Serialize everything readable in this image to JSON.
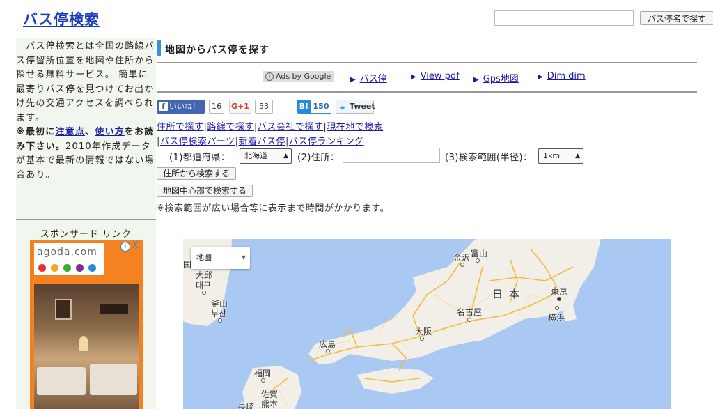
{
  "header": {
    "site_title": "バス停検索",
    "search_button": "バス停名で探す"
  },
  "sidebar": {
    "intro_1": "　バス停検索とは全国の路線バス停留所位置を地図や住所から探せる無料サービス。 簡単に最寄りバス停を見つけてお出かけ先の交通アクセスを調べられます。",
    "intro_2a": "※最初に",
    "intro_link1": "注意点",
    "intro_2b": "、",
    "intro_link2": "使い方",
    "intro_2c": "をお読み下さい。",
    "intro_3": "2010年作成データが基本で最新の情報ではない場合あり。",
    "sponsor_label": "スポンサード リンク",
    "ad": {
      "logo": "agoda.com",
      "info": "i",
      "close": "X",
      "dot_colors": [
        "#e5322d",
        "#f5a623",
        "#3aaa35",
        "#7b2d8e",
        "#2a8ad6"
      ]
    }
  },
  "main": {
    "heading": "地図からバス停を探す",
    "ads_by_google": "Ads by Google",
    "ad_links": [
      "バス停",
      "View pdf",
      "Gps地図",
      "Dim dim"
    ],
    "social": {
      "fb_label": "いいね！",
      "fb_count": "16",
      "gplus_label": "G+1",
      "gplus_count": "53",
      "hatena_label": "B!",
      "hatena_count": "150",
      "tweet_label": "Tweet"
    },
    "nav1": {
      "items": [
        "住所で探す",
        "路線で探す",
        "バス会社で探す",
        "現在地で検索"
      ]
    },
    "nav2": {
      "items": [
        "バス停検索パーツ",
        "新着バス停",
        "バス停ランキング"
      ]
    },
    "form": {
      "pref_label": "(1)都道府県：",
      "pref_value": "北海道",
      "address_label": "(2)住所：",
      "range_label": "(3)検索範囲(半径)：",
      "range_value": "1km",
      "search_address_btn": "住所から検索する",
      "search_center_btn": "地図中心部で検索する",
      "note": "※検索範囲が広い場合等に表示まで時間がかかります。"
    },
    "map": {
      "type_selector": "地圖",
      "labels": {
        "kanazawa": "金沢",
        "toyama": "富山",
        "nihon": "日 本",
        "tokyo": "東京",
        "yokohama": "横浜",
        "nagoya": "名古屋",
        "osaka": "大阪",
        "hiroshima": "広島",
        "fukuoka": "福岡",
        "saga": "佐賀",
        "kumamoto": "熊本",
        "nagasaki": "長崎",
        "daegu": "大邱",
        "daegu2": "대구",
        "busan": "釜山",
        "busan2": "부산",
        "edge": "国"
      },
      "land_color": "#f2efe9",
      "sea_color": "#a9c8f2",
      "road_color": "#f4b942"
    }
  }
}
